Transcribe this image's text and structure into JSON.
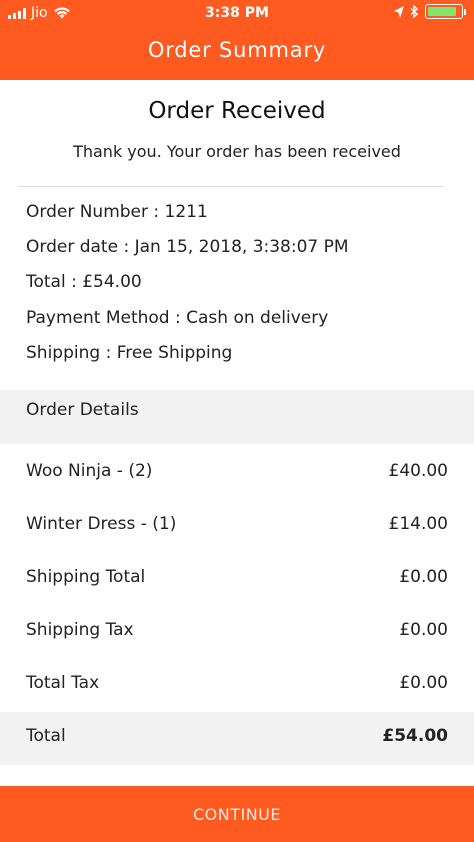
{
  "status_bar": {
    "carrier": "Jio",
    "time": "3:38 PM"
  },
  "header": {
    "title": "Order Summary"
  },
  "confirmation": {
    "title": "Order Received",
    "subtitle": "Thank you. Your order has been received"
  },
  "order_info": [
    "Order Number : 1211",
    "Order date : Jan 15, 2018, 3:38:07 PM",
    "Total : £54.00",
    "Payment Method : Cash on delivery",
    "Shipping : Free Shipping"
  ],
  "details": {
    "heading": "Order Details",
    "rows": [
      {
        "label": "Woo Ninja - (2)",
        "value": "£40.00"
      },
      {
        "label": "Winter Dress - (1)",
        "value": "£14.00"
      },
      {
        "label": "Shipping Total",
        "value": "£0.00"
      },
      {
        "label": "Shipping Tax",
        "value": "£0.00"
      },
      {
        "label": "Total Tax",
        "value": "£0.00"
      }
    ],
    "total": {
      "label": "Total",
      "value": "£54.00"
    }
  },
  "footer": {
    "continue_label": "CONTINUE"
  },
  "colors": {
    "accent": "#ff5a1f",
    "section_bg": "#f2f2f2",
    "battery": "#7fe86a"
  }
}
